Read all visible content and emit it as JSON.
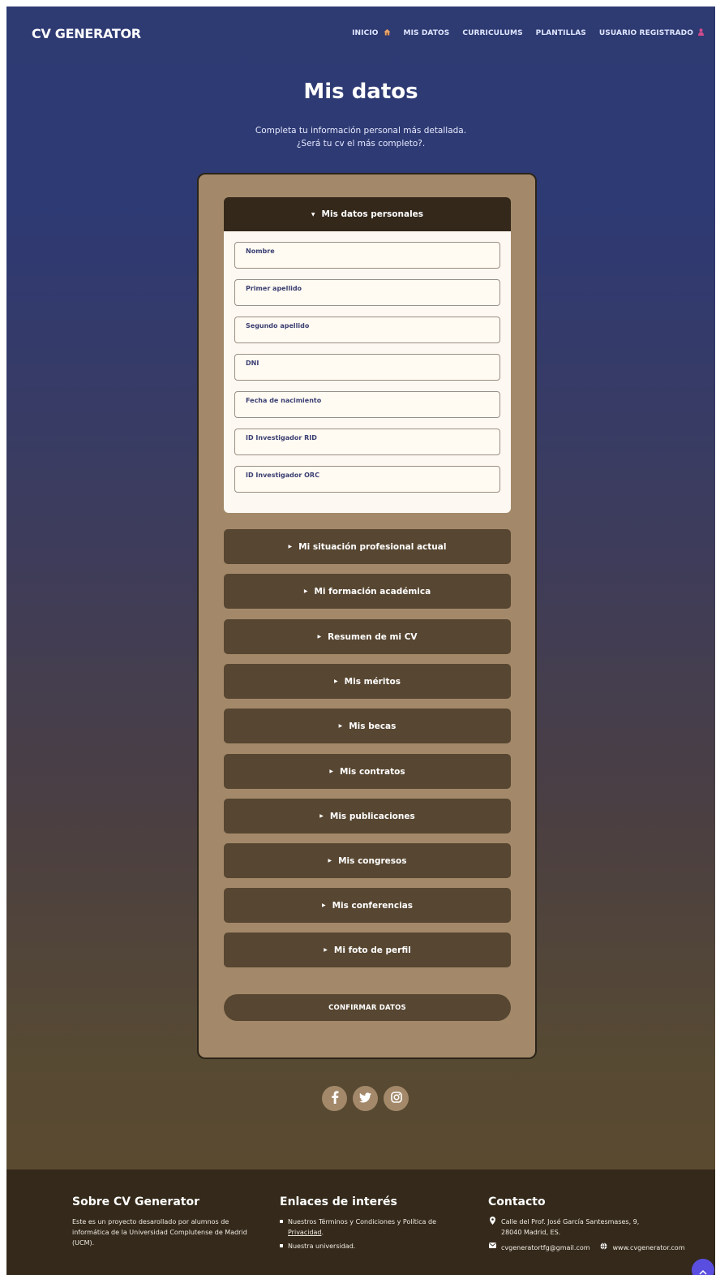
{
  "header": {
    "logo": "CV GENERATOR",
    "nav": [
      {
        "label": "INICIO",
        "icon": "home-icon"
      },
      {
        "label": "MIS DATOS"
      },
      {
        "label": "CURRICULUMS"
      },
      {
        "label": "PLANTILLAS"
      },
      {
        "label": "USUARIO REGISTRADO",
        "icon": "user-icon"
      }
    ]
  },
  "hero": {
    "title": "Mis datos",
    "subtitle_line1": "Completa tu información personal más detallada.",
    "subtitle_line2": "¿Será tu cv el más completo?."
  },
  "form": {
    "open_section": {
      "title": "Mis datos personales",
      "fields": [
        {
          "label": "Nombre",
          "value": ""
        },
        {
          "label": "Primer apellido",
          "value": ""
        },
        {
          "label": "Segundo apellido",
          "value": ""
        },
        {
          "label": "DNI",
          "value": ""
        },
        {
          "label": "Fecha de nacimiento",
          "value": ""
        },
        {
          "label": "ID Investigador RID",
          "value": ""
        },
        {
          "label": "ID Investigador ORC",
          "value": ""
        }
      ]
    },
    "sections": [
      "Mi situación profesional actual",
      "Mi formación académica",
      "Resumen de mi CV",
      "Mis méritos",
      "Mis becas",
      "Mis contratos",
      "Mis publicaciones",
      "Mis congresos",
      "Mis conferencias",
      "Mi foto de perfil"
    ],
    "confirm_label": "CONFIRMAR DATOS"
  },
  "social": [
    "facebook-icon",
    "twitter-icon",
    "instagram-icon"
  ],
  "footer": {
    "about": {
      "title": "Sobre CV Generator",
      "text": "Este es un proyecto desarollado por alumnos de informática de la Universidad Complutense de Madrid (UCM)."
    },
    "links": {
      "title": "Enlaces de interés",
      "item1_prefix": "Nuestros Términos y Condiciones y Política de ",
      "item1_link": "Privacidad",
      "item1_suffix": ".",
      "item2": "Nuestra universidad."
    },
    "contact": {
      "title": "Contacto",
      "address_line1": "Calle del Prof. José García Santesmases, 9,",
      "address_line2": "28040 Madrid, ES.",
      "email": "cvgeneratortfg@gmail.com",
      "website": "www.cvgenerator.com"
    }
  },
  "colors": {
    "nav_bg_top": "#2e3a72",
    "card_bg": "#a3896a",
    "accordion_bg": "#574631",
    "footer_bg": "#34291a",
    "field_label": "#3a3f72"
  }
}
